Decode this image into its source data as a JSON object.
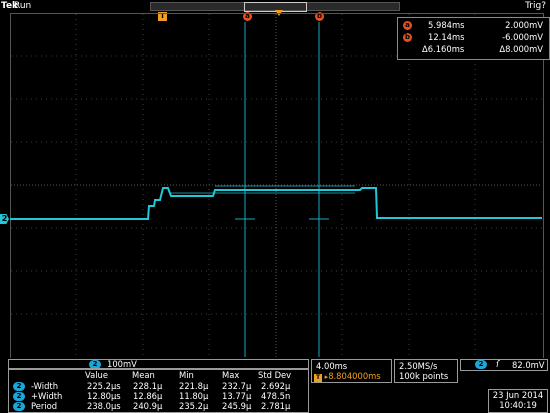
{
  "topbar": {
    "brand": "Tek",
    "state": "Run",
    "trigger_state": "Trig?"
  },
  "markers": {
    "trigger_pos": "T",
    "cursor_a": "a",
    "cursor_b": "b"
  },
  "cursor_readout": {
    "a": {
      "label": "a",
      "time": "5.984ms",
      "value": "2.000mV"
    },
    "b": {
      "label": "b",
      "time": "12.14ms",
      "value": "-6.000mV"
    },
    "delta": {
      "time": "Δ6.160ms",
      "value": "Δ8.000mV"
    }
  },
  "channel_marker": "2",
  "channel": {
    "badge": "2",
    "scale": "100mV"
  },
  "measurements": {
    "headers": [
      "Value",
      "Mean",
      "Min",
      "Max",
      "Std Dev"
    ],
    "rows": [
      {
        "ch": "2",
        "name": "-Width",
        "value": "225.2µs",
        "mean": "228.1µ",
        "min": "221.8µ",
        "max": "232.7µ",
        "std": "2.692µ"
      },
      {
        "ch": "2",
        "name": "+Width",
        "value": "12.80µs",
        "mean": "12.86µ",
        "min": "11.80µ",
        "max": "13.77µ",
        "std": "478.5n"
      },
      {
        "ch": "2",
        "name": "Period",
        "value": "238.0µs",
        "mean": "240.9µ",
        "min": "235.2µ",
        "max": "245.9µ",
        "std": "2.781µ"
      }
    ]
  },
  "horizontal": {
    "scale": "4.00ms",
    "position": "8.804000ms"
  },
  "acquisition": {
    "rate": "2.50MS/s",
    "points": "100k points"
  },
  "trigger": {
    "channel": "2",
    "slope": "rising-edge-icon",
    "level": "82.0mV"
  },
  "datetime": {
    "date": "23 Jun 2014",
    "time": "10:40:19"
  },
  "colors": {
    "trace": "#20c8d8",
    "cursor": "#1aa7c0",
    "marker": "#e8501e",
    "trigger": "#f0a020"
  }
}
